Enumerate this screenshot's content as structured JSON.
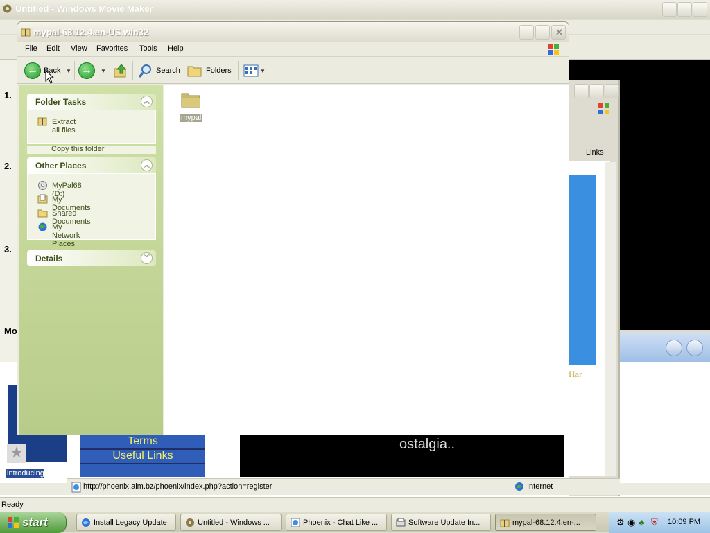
{
  "movie_maker": {
    "title": "Untitled - Windows Movie Maker",
    "task_numbers": [
      "1.",
      "2.",
      "3."
    ],
    "movie_label": "Mo",
    "thumb_caption": "introducing",
    "status": "Ready"
  },
  "ie": {
    "links_label": "Links",
    "side_link_text": "Har",
    "nav_links": [
      "Terms",
      "Useful Links"
    ],
    "banner_text": "ostalgia..",
    "status_url": "http://phoenix.aim.bz/phoenix/index.php?action=register",
    "zone": "Internet"
  },
  "explorer": {
    "title": "mypal-68.12.4.en-US.win32",
    "menu": [
      "File",
      "Edit",
      "View",
      "Favorites",
      "Tools",
      "Help"
    ],
    "toolbar": {
      "back": "Back",
      "search": "Search",
      "folders": "Folders"
    },
    "folder_tasks": {
      "title": "Folder Tasks",
      "items": [
        "Extract all files",
        "Copy this folder"
      ]
    },
    "other_places": {
      "title": "Other Places",
      "items": [
        "MyPal68 (D:)",
        "My Documents",
        "Shared Documents",
        "My Network Places"
      ]
    },
    "details": {
      "title": "Details"
    },
    "files": [
      {
        "name": "mypal",
        "icon": "folder-icon"
      }
    ]
  },
  "taskbar": {
    "start": "start",
    "buttons": [
      {
        "label": "Install Legacy Update",
        "icon": "globe-icon"
      },
      {
        "label": "Untitled - Windows ...",
        "icon": "movie-maker-icon"
      },
      {
        "label": "Phoenix - Chat Like ...",
        "icon": "ie-icon"
      },
      {
        "label": "Software Update In...",
        "icon": "installer-icon"
      },
      {
        "label": "mypal-68.12.4.en-...",
        "icon": "zip-folder-icon"
      }
    ],
    "clock": "10:09 PM"
  },
  "colors": {
    "task_pane": "#cfe1a6",
    "explorer_titlebar": "#dedcce",
    "start_button": "#4f9a3a",
    "ie_blue": "#3b8fe0"
  }
}
